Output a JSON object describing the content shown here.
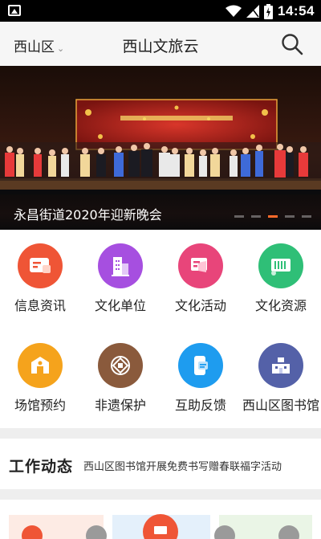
{
  "status_bar": {
    "time": "14:54"
  },
  "header": {
    "region": "西山区",
    "title": "西山文旅云"
  },
  "banner": {
    "caption": "永昌街道2020年迎新晚会",
    "dots_total": 5,
    "active_dot": 3
  },
  "categories": [
    {
      "label": "信息资讯",
      "icon": "news-icon",
      "color": "#ef5536"
    },
    {
      "label": "文化单位",
      "icon": "building-icon",
      "color": "#a64fe0"
    },
    {
      "label": "文化活动",
      "icon": "activity-icon",
      "color": "#e8457a"
    },
    {
      "label": "文化资源",
      "icon": "resource-icon",
      "color": "#2fbf77"
    },
    {
      "label": "场馆预约",
      "icon": "venue-icon",
      "color": "#f5a31c"
    },
    {
      "label": "非遗保护",
      "icon": "heritage-icon",
      "color": "#8a5a3c"
    },
    {
      "label": "互助反馈",
      "icon": "feedback-icon",
      "color": "#1e9cef"
    },
    {
      "label": "西山区图书馆",
      "icon": "library-icon",
      "color": "#5461a8"
    }
  ],
  "news": {
    "heading": "工作动态",
    "item": "西山区图书馆开展免费书写赠春联福字活动"
  }
}
